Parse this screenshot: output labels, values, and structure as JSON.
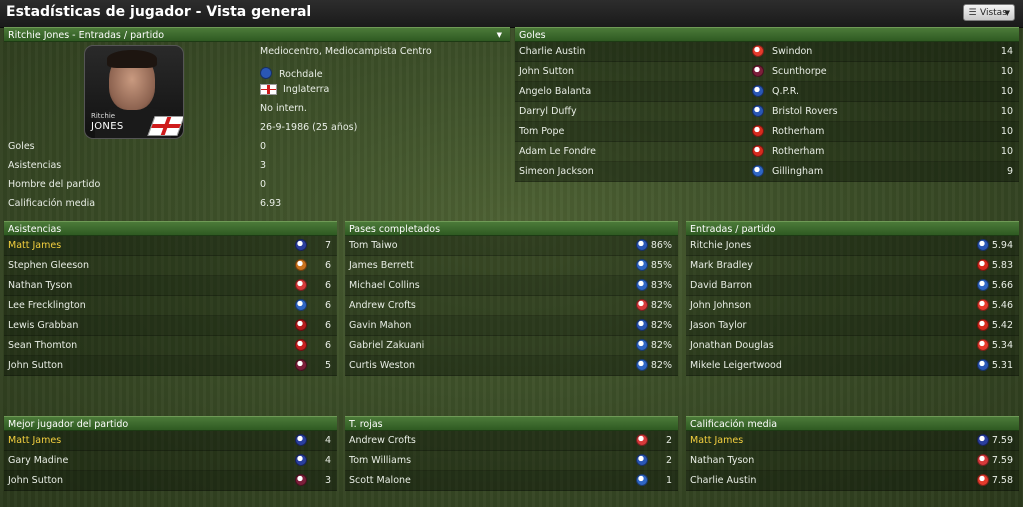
{
  "page": {
    "title": "Estadísticas de jugador - Vista general",
    "views_label": "Vistas"
  },
  "player": {
    "selector_label": "Ritchie Jones - Entradas / partido",
    "photo_first": "Ritchie",
    "photo_last": "JONES",
    "position": "Mediocentro, Mediocampista Centro",
    "club": "Rochdale",
    "nation": "Inglaterra",
    "intl": "No intern.",
    "dob": "26-9-1986 (25 años)",
    "stats": [
      {
        "label": "Goles",
        "value": "0"
      },
      {
        "label": "Asistencias",
        "value": "3"
      },
      {
        "label": "Hombre del partido",
        "value": "0"
      },
      {
        "label": "Calificación media",
        "value": "6.93"
      }
    ]
  },
  "goals": {
    "title": "Goles",
    "rows": [
      {
        "name": "Charlie Austin",
        "club": "Swindon",
        "value": "14",
        "color": "#e53b2c"
      },
      {
        "name": "John Sutton",
        "club": "Scunthorpe",
        "value": "10",
        "color": "#7c1f3a"
      },
      {
        "name": "Angelo Balanta",
        "club": "Q.P.R.",
        "value": "10",
        "color": "#2a57b5"
      },
      {
        "name": "Darryl Duffy",
        "club": "Bristol Rovers",
        "value": "10",
        "color": "#2a57b5"
      },
      {
        "name": "Tom Pope",
        "club": "Rotherham",
        "value": "10",
        "color": "#d62b1e"
      },
      {
        "name": "Adam Le Fondre",
        "club": "Rotherham",
        "value": "10",
        "color": "#d62b1e"
      },
      {
        "name": "Simeon Jackson",
        "club": "Gillingham",
        "value": "9",
        "color": "#2f66c4"
      }
    ]
  },
  "assists": {
    "title": "Asistencias",
    "rows": [
      {
        "name": "Matt James",
        "value": "7",
        "highlight": true,
        "color": "#2a3f9e"
      },
      {
        "name": "Stephen Gleeson",
        "value": "6",
        "highlight": false,
        "color": "#c9721d"
      },
      {
        "name": "Nathan Tyson",
        "value": "6",
        "highlight": false,
        "color": "#d63a3a"
      },
      {
        "name": "Lee Frecklington",
        "value": "6",
        "highlight": false,
        "color": "#2f66c4"
      },
      {
        "name": "Lewis Grabban",
        "value": "6",
        "highlight": false,
        "color": "#b51d1d"
      },
      {
        "name": "Sean Thomton",
        "value": "6",
        "highlight": false,
        "color": "#c82020"
      },
      {
        "name": "John Sutton",
        "value": "5",
        "highlight": false,
        "color": "#7c1f3a"
      }
    ]
  },
  "passes": {
    "title": "Pases completados",
    "rows": [
      {
        "name": "Tom Taiwo",
        "value": "86%",
        "color": "#2a57b5"
      },
      {
        "name": "James Berrett",
        "value": "85%",
        "color": "#2f66c4"
      },
      {
        "name": "Michael Collins",
        "value": "83%",
        "color": "#2f66c4"
      },
      {
        "name": "Andrew Crofts",
        "value": "82%",
        "color": "#d63a3a"
      },
      {
        "name": "Gavin Mahon",
        "value": "82%",
        "color": "#2a57b5"
      },
      {
        "name": "Gabriel Zakuani",
        "value": "82%",
        "color": "#2f66c4"
      },
      {
        "name": "Curtis Weston",
        "value": "82%",
        "color": "#2f66c4"
      }
    ]
  },
  "tackles": {
    "title": "Entradas / partido",
    "rows": [
      {
        "name": "Ritchie Jones",
        "value": "5.94",
        "color": "#2a57b5"
      },
      {
        "name": "Mark Bradley",
        "value": "5.83",
        "color": "#d62b1e"
      },
      {
        "name": "David Barron",
        "value": "5.66",
        "color": "#2f66c4"
      },
      {
        "name": "John Johnson",
        "value": "5.46",
        "color": "#e53b2c"
      },
      {
        "name": "Jason Taylor",
        "value": "5.42",
        "color": "#d62b1e"
      },
      {
        "name": "Jonathan Douglas",
        "value": "5.34",
        "color": "#e53b2c"
      },
      {
        "name": "Mikele Leigertwood",
        "value": "5.31",
        "color": "#2a57b5"
      }
    ]
  },
  "motm": {
    "title": "Mejor jugador del partido",
    "rows": [
      {
        "name": "Matt James",
        "value": "4",
        "highlight": true,
        "color": "#2a3f9e"
      },
      {
        "name": "Gary Madine",
        "value": "4",
        "highlight": false,
        "color": "#2a3f9e"
      },
      {
        "name": "John Sutton",
        "value": "3",
        "highlight": false,
        "color": "#7c1f3a"
      }
    ]
  },
  "reds": {
    "title": "T. rojas",
    "rows": [
      {
        "name": "Andrew Crofts",
        "value": "2",
        "color": "#d63a3a"
      },
      {
        "name": "Tom Williams",
        "value": "2",
        "color": "#2a57b5"
      },
      {
        "name": "Scott Malone",
        "value": "1",
        "color": "#2f66c4"
      }
    ]
  },
  "rating": {
    "title": "Calificación media",
    "rows": [
      {
        "name": "Matt James",
        "value": "7.59",
        "highlight": true,
        "color": "#2a3f9e"
      },
      {
        "name": "Nathan Tyson",
        "value": "7.59",
        "highlight": false,
        "color": "#d63a3a"
      },
      {
        "name": "Charlie Austin",
        "value": "7.58",
        "highlight": false,
        "color": "#e53b2c"
      }
    ]
  }
}
